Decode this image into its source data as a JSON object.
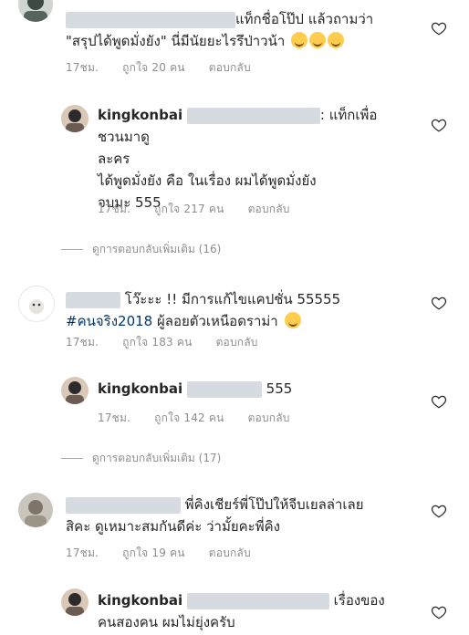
{
  "comments": [
    {
      "text_lines": [
        "แท็กชื่อโป๊ป แล้วถามว่า",
        "\"สรุปได้พูดมั่งยัง\" นี่มีนัยยะไรรึป่าวน้า"
      ],
      "time": "17ชม.",
      "likes": "ถูกใจ 20 คน",
      "reply": "ตอบกลับ",
      "emoji": [
        "rofl-emoji",
        "rofl-emoji",
        "rofl-emoji"
      ]
    },
    {
      "username": "kingkonbai",
      "text_lines": [
        ": แท็กเพื่อชวนมาดู",
        "ละคร",
        "ได้พูดมั่งยัง คือ ในเรื่อง ผมได้พูดมั่งยัง",
        "จบมะ 555"
      ],
      "time": "17ชม.",
      "likes": "ถูกใจ 217 คน",
      "reply": "ตอบกลับ"
    },
    {
      "text_line1": "โว๊ะะะ !! มีการแก้ไขแคปชั่น 55555",
      "hashtag": "#คนจริง2018",
      "text_line2": " ผู้ลอยตัวเหนือดราม่า",
      "emoji": [
        "grin-sweat-emoji"
      ],
      "time": "17ชม.",
      "likes": "ถูกใจ 183 คน",
      "reply": "ตอบกลับ"
    },
    {
      "username": "kingkonbai",
      "text": "555",
      "time": "17ชม.",
      "likes": "ถูกใจ 142 คน",
      "reply": "ตอบกลับ"
    },
    {
      "text_lines": [
        "พี่คิงเชียร์พี่โป๊ปให้จีบเยลล่าเลย",
        "สิคะ ดูเหมาะสมกันดีค่ะ ว่ามั้ยคะพี่คิง"
      ],
      "time": "17ชม.",
      "likes": "ถูกใจ 19 คน",
      "reply": "ตอบกลับ"
    },
    {
      "username": "kingkonbai",
      "text_lines": [
        "เรื่องของ",
        "คนสองคน ผมไม่ยุ่งครับ"
      ]
    }
  ],
  "view_more": [
    "ดูการตอบกลับเพิ่มเติม (16)",
    "ดูการตอบกลับเพิ่มเติม (17)"
  ],
  "colors": {
    "meta": "#8e8e8e",
    "hashtag": "#00376b",
    "text": "#262626"
  }
}
